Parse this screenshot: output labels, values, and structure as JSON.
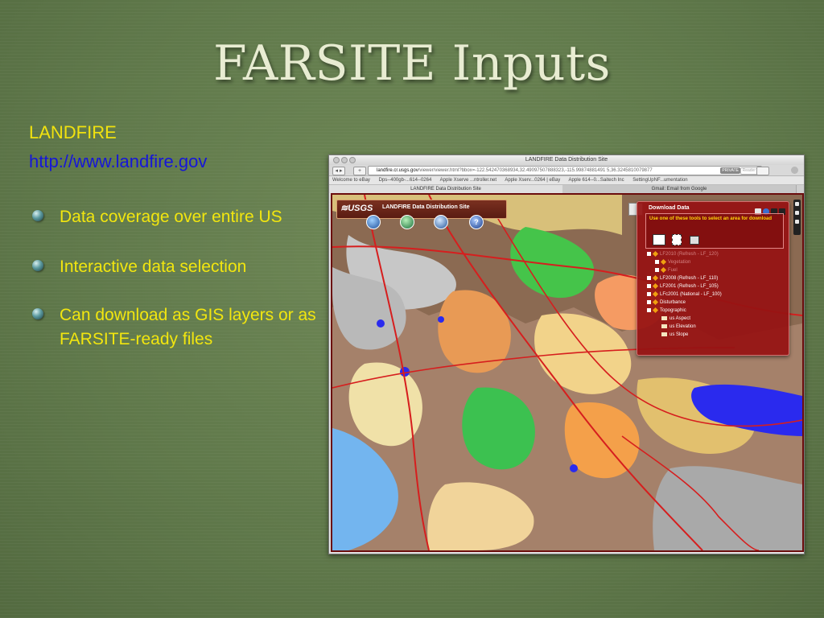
{
  "slide": {
    "title": "FARSITE Inputs",
    "section_heading": "LANDFIRE",
    "section_url": "http://www.landfire.gov",
    "bullets": [
      "Data coverage over entire US",
      "Interactive data selection",
      "Can download as GIS layers or as FARSITE-ready files"
    ],
    "colors": {
      "accent_text": "#f2e60f",
      "link": "#1616d8",
      "title": "#e8ecd2"
    }
  },
  "browser": {
    "window_title": "LANDFIRE Data Distribution Site",
    "url_host": "landfire.cr.usgs.gov",
    "url_rest": "/viewer/viewer.html?bbox=-122.542470368934,32.49097507888323,-115.99874881491 5,36.3245810079877",
    "private_label": "PRIVATE",
    "reader_label": "Reader",
    "bookmarks": [
      "Welcome to eBay",
      "Dps--400gb-...614--0264",
      "Apple Xserve ...ntroller.net",
      "Apple Xserv...0264 | eBay",
      "Apple 614--0...Saitech Inc",
      "SettingUpNF...umentation"
    ],
    "tabs": [
      "LANDFIRE Data Distribution Site",
      "Gmail: Email from Google"
    ]
  },
  "viewer": {
    "logo": "≋USGS",
    "site_title": "LANDFIRE Data Distribution Site",
    "help_glyph": "?",
    "download_panel": {
      "title": "Download Data",
      "instructions": "Use one of these tools to select an area for download",
      "tree": [
        {
          "label": "LF2010 (Refresh - LF_120)",
          "level": 0,
          "dim": true
        },
        {
          "label": "Vegetation",
          "level": 1,
          "dim": true
        },
        {
          "label": "Fuel",
          "level": 1,
          "dim": true
        },
        {
          "label": "LF2008 (Refresh - LF_110)",
          "level": 0,
          "dim": false
        },
        {
          "label": "LF2001 (Refresh - LF_105)",
          "level": 0,
          "dim": false
        },
        {
          "label": "LFc2001 (National - LF_100)",
          "level": 0,
          "dim": false
        },
        {
          "label": "Disturbance",
          "level": 0,
          "dim": false
        },
        {
          "label": "Topographic",
          "level": 0,
          "dim": false
        },
        {
          "label": "us Aspect",
          "level": 2,
          "dim": false
        },
        {
          "label": "us Elevation",
          "level": 2,
          "dim": false
        },
        {
          "label": "us Slope",
          "level": 2,
          "dim": false
        }
      ]
    }
  }
}
